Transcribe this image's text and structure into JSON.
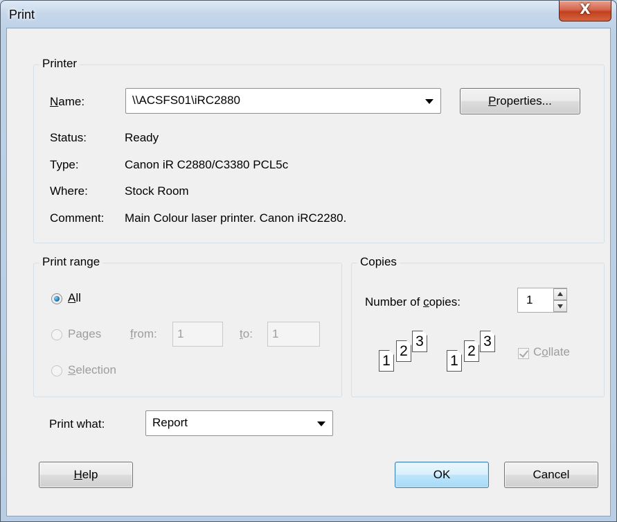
{
  "window": {
    "title": "Print",
    "close_glyph": "X"
  },
  "printer": {
    "group_label": "Printer",
    "name_label_pre": "",
    "name_label_ak": "N",
    "name_label_post": "ame:",
    "name_value": "\\\\ACSFS01\\iRC2880",
    "properties_pre": "",
    "properties_ak": "P",
    "properties_post": "roperties...",
    "status_label": "Status:",
    "status_value": "Ready",
    "type_label": "Type:",
    "type_value": "Canon iR C2880/C3380 PCL5c",
    "where_label": "Where:",
    "where_value": "Stock Room",
    "comment_label": "Comment:",
    "comment_value": "Main Colour laser printer. Canon iRC2280."
  },
  "print_range": {
    "group_label": "Print range",
    "all_ak": "A",
    "all_post": "ll",
    "pages_pre": "Pa",
    "pages_ak": "g",
    "pages_post": "es",
    "from_ak": "f",
    "from_post": "rom:",
    "from_value": "1",
    "to_ak": "t",
    "to_post": "o:",
    "to_value": "1",
    "selection_ak": "S",
    "selection_post": "election",
    "selected": "All"
  },
  "copies": {
    "group_label": "Copies",
    "number_pre": "Number of ",
    "number_ak": "c",
    "number_post": "opies:",
    "number_value": "1",
    "collate_pre": "C",
    "collate_ak": "o",
    "collate_post": "llate",
    "collate_checked": true,
    "page_numbers": [
      "1",
      "2",
      "3"
    ]
  },
  "print_what": {
    "label": "Print what:",
    "value": "Report"
  },
  "buttons": {
    "help_ak": "H",
    "help_post": "elp",
    "ok": "OK",
    "cancel": "Cancel"
  }
}
